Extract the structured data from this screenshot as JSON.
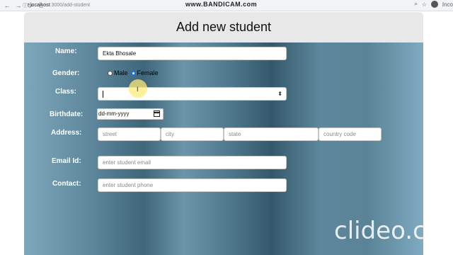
{
  "browser": {
    "url_host": "localhost",
    "url_path": ":3000/add-student",
    "recorder_watermark": "www.BANDICAM.com",
    "profile_text": "Inco"
  },
  "page": {
    "title": "Add new student"
  },
  "form": {
    "name_label": "Name:",
    "name_value": "Ekta Bhosale",
    "gender_label": "Gender:",
    "gender_male": "Male",
    "gender_female": "Female",
    "gender_selected": "Female",
    "class_label": "Class:",
    "class_value": "",
    "birthdate_label": "Birthdate:",
    "birthdate_value": "dd-mm-yyyy",
    "address_label": "Address:",
    "street_placeholder": "street",
    "city_placeholder": "city",
    "state_placeholder": "state",
    "country_placeholder": "country code",
    "email_label": "Email Id:",
    "email_placeholder": "enter student email",
    "contact_label": "Contact:",
    "contact_placeholder": "enter student phone"
  },
  "overlay": {
    "video_watermark": "clideo.com"
  },
  "colors": {
    "header_bg": "#e8e8e8",
    "form_bg": "#5b8499",
    "radio_accent": "#1a73e8"
  }
}
